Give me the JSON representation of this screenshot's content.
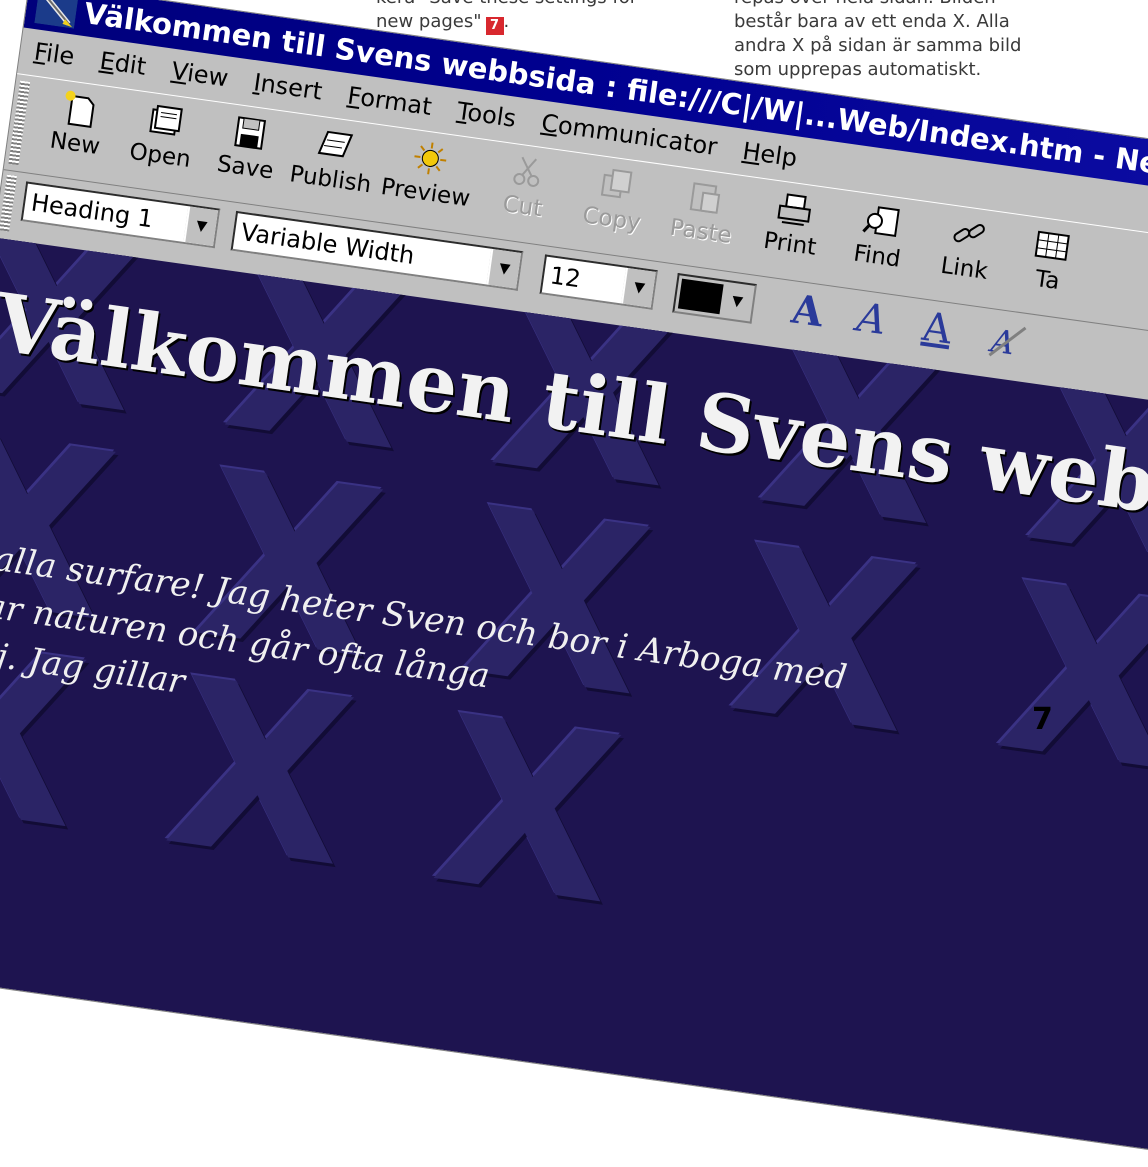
{
  "captions": {
    "left_lines": [
      "kera \"Save these settings for",
      "new pages\""
    ],
    "left_marker": "7",
    "right_lines": [
      "repas över hela sidan. Bilden",
      "består bara av ett enda X. Alla",
      "andra X på sidan är samma bild",
      "som upprepas automatiskt."
    ]
  },
  "window": {
    "title": "Välkommen till Svens webbsida : file:///C|/W|...Web/Index.htm - Net",
    "menu": [
      "File",
      "Edit",
      "View",
      "Insert",
      "Format",
      "Tools",
      "Communicator",
      "Help"
    ],
    "toolbar": {
      "buttons": [
        {
          "label": "New",
          "icon": "new-page-icon",
          "enabled": true
        },
        {
          "label": "Open",
          "icon": "open-folder-icon",
          "enabled": true
        },
        {
          "label": "Save",
          "icon": "floppy-disk-icon",
          "enabled": true
        },
        {
          "label": "Publish",
          "icon": "publish-icon",
          "enabled": true
        },
        {
          "label": "Preview",
          "icon": "preview-sun-icon",
          "enabled": true
        },
        {
          "label": "Cut",
          "icon": "scissors-icon",
          "enabled": false
        },
        {
          "label": "Copy",
          "icon": "copy-icon",
          "enabled": false
        },
        {
          "label": "Paste",
          "icon": "paste-icon",
          "enabled": false
        },
        {
          "label": "Print",
          "icon": "printer-icon",
          "enabled": true
        },
        {
          "label": "Find",
          "icon": "find-icon",
          "enabled": true
        },
        {
          "label": "Link",
          "icon": "chain-link-icon",
          "enabled": true
        },
        {
          "label": "Ta",
          "icon": "table-icon",
          "enabled": true
        }
      ]
    },
    "format_bar": {
      "style": "Heading 1",
      "font": "Variable Width",
      "size": "12",
      "text_color": "#000000"
    }
  },
  "page": {
    "heading": "Välkommen till Svens webbsida",
    "body_lines": [
      "Hej alla surfare! Jag heter Sven och bor i Arboga med",
      "älskar naturen och går ofta långa",
      "familj. Jag gillar"
    ],
    "background_color": "#1e1450"
  },
  "page_number": "7"
}
